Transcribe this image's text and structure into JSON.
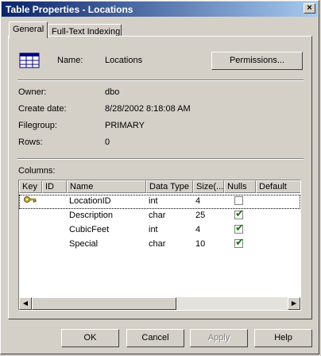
{
  "window": {
    "title": "Table Properties - Locations",
    "close_glyph": "×"
  },
  "tabs": [
    {
      "label": "General"
    },
    {
      "label": "Full-Text Indexing"
    }
  ],
  "general": {
    "name_label": "Name:",
    "name_value": "Locations",
    "permissions_label": "Permissions...",
    "owner_label": "Owner:",
    "owner_value": "dbo",
    "create_date_label": "Create date:",
    "create_date_value": "8/28/2002 8:18:08 AM",
    "filegroup_label": "Filegroup:",
    "filegroup_value": "PRIMARY",
    "rows_label": "Rows:",
    "rows_value": "0",
    "columns_label": "Columns:"
  },
  "columns_grid": {
    "headers": [
      "Key",
      "ID",
      "Name",
      "Data Type",
      "Size(...",
      "Nulls",
      "Default"
    ],
    "rows": [
      {
        "key": true,
        "id": "",
        "name": "LocationID",
        "data_type": "int",
        "size": "4",
        "nulls": false
      },
      {
        "key": false,
        "id": "",
        "name": "Description",
        "data_type": "char",
        "size": "25",
        "nulls": true
      },
      {
        "key": false,
        "id": "",
        "name": "CubicFeet",
        "data_type": "int",
        "size": "4",
        "nulls": true
      },
      {
        "key": false,
        "id": "",
        "name": "Special",
        "data_type": "char",
        "size": "10",
        "nulls": true
      }
    ],
    "scroll_left_glyph": "◀",
    "scroll_right_glyph": "▶"
  },
  "buttons": {
    "ok": "OK",
    "cancel": "Cancel",
    "apply": "Apply",
    "help": "Help"
  },
  "colors": {
    "title_gradient_start": "#0a246a",
    "title_gradient_end": "#a6caf0",
    "face": "#d4d0c8",
    "check_green": "#008000"
  },
  "icons": {
    "table": "table-icon",
    "key": "key-icon",
    "checkbox": "checkbox-icon"
  }
}
